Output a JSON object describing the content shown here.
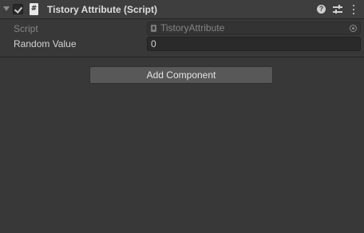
{
  "component": {
    "title": "Tistory Attribute (Script)",
    "enabled": true,
    "icon": "script-icon",
    "header_icons": [
      "help-icon",
      "preset-icon",
      "kebab-menu-icon"
    ]
  },
  "fields": {
    "script": {
      "label": "Script",
      "value": "TistoryAttribute"
    },
    "random_value": {
      "label": "Random Value",
      "value": "0"
    }
  },
  "add_component_label": "Add Component"
}
